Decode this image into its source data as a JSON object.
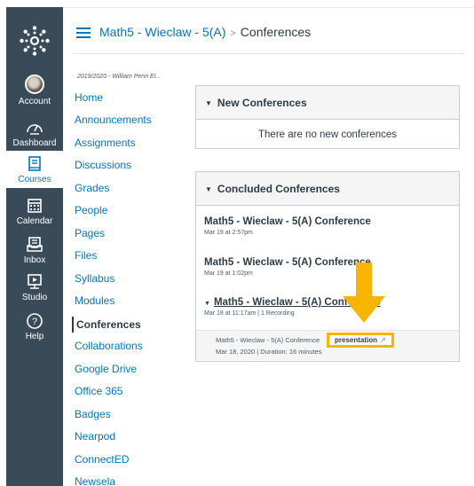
{
  "global_nav": {
    "items": [
      {
        "label": "Account",
        "icon": "avatar"
      },
      {
        "label": "Dashboard",
        "icon": "speedometer-icon"
      },
      {
        "label": "Courses",
        "icon": "book-icon",
        "active": true
      },
      {
        "label": "Calendar",
        "icon": "calendar-icon"
      },
      {
        "label": "Inbox",
        "icon": "inbox-icon"
      },
      {
        "label": "Studio",
        "icon": "studio-icon"
      },
      {
        "label": "Help",
        "icon": "help-icon"
      }
    ]
  },
  "header": {
    "course": "Math5 - Wieclaw - 5(A)",
    "separator": ">",
    "current": "Conferences"
  },
  "course_nav": {
    "term": "2019/2020 - William Penn El...",
    "items": [
      "Home",
      "Announcements",
      "Assignments",
      "Discussions",
      "Grades",
      "People",
      "Pages",
      "Files",
      "Syllabus",
      "Modules",
      "Conferences",
      "Collaborations",
      "Google Drive",
      "Office 365",
      "Badges",
      "Nearpod",
      "ConnectED",
      "Newsela"
    ],
    "active": "Conferences"
  },
  "new_conferences": {
    "heading": "New Conferences",
    "empty_text": "There are no new conferences"
  },
  "concluded_conferences": {
    "heading": "Concluded Conferences",
    "items": [
      {
        "title": "Math5 - Wieclaw - 5(A) Conference",
        "meta": "Mar 19 at 2:57pm"
      },
      {
        "title": "Math5 - Wieclaw - 5(A) Conference",
        "meta": "Mar 19 at 1:02pm"
      },
      {
        "title": "Math5 - Wieclaw - 5(A) Conference",
        "meta": "Mar 18 at 11:17am | 1 Recording"
      }
    ],
    "recording": {
      "name": "Math5 - Wieclaw - 5(A) Conference",
      "date": "Mar 18, 2020 | Duration: 16 minutes",
      "button": "presentation"
    }
  },
  "colors": {
    "sidebar": "#394b58",
    "link": "#0374b5",
    "highlight": "#f7b500"
  }
}
